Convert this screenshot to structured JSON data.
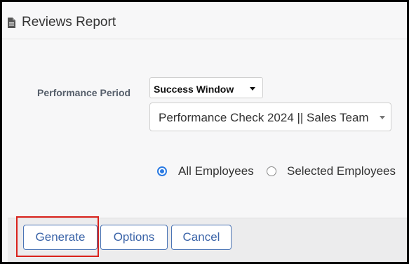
{
  "header": {
    "title": "Reviews Report",
    "icon": "document-icon"
  },
  "form": {
    "period_label": "Performance Period",
    "period_type": {
      "value": "Success Window"
    },
    "period": {
      "value": "Performance Check 2024 || Sales Team"
    },
    "scope": {
      "options": [
        {
          "label": "All Employees",
          "checked": true
        },
        {
          "label": "Selected Employees",
          "checked": false
        }
      ]
    }
  },
  "footer": {
    "generate_label": "Generate",
    "options_label": "Options",
    "cancel_label": "Cancel"
  },
  "colors": {
    "accent": "#2a7ae2",
    "button_text": "#3b64a8",
    "highlight": "#d9221c"
  }
}
